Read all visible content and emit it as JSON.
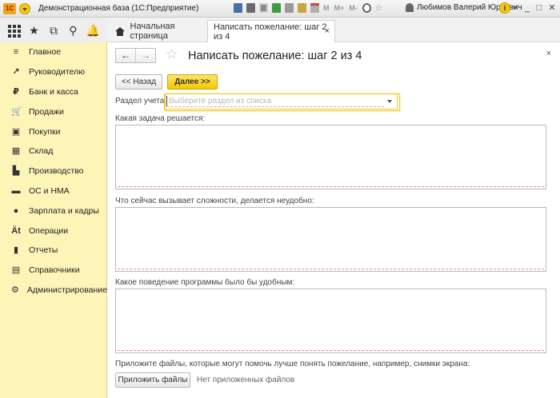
{
  "titlebar": {
    "logo_text": "1С",
    "app_title": "Демонстрационная база  (1С:Предприятие)",
    "m_buttons": [
      "M",
      "M+",
      "M-"
    ],
    "user_name": "Любимов Валерий Юрьевич",
    "info_glyph": "i",
    "minimize": "_",
    "maximize": "□",
    "close": "✕"
  },
  "topnav": {
    "home_tab": "Начальная страница",
    "active_tab": "Написать пожелание: шаг 2 из 4",
    "active_tab_close": "×"
  },
  "sidebar": {
    "items": [
      {
        "label": "Главное",
        "icon": "menu-lines-icon",
        "glyph": "≡"
      },
      {
        "label": "Руководителю",
        "icon": "trend-icon",
        "glyph": "↗"
      },
      {
        "label": "Банк и касса",
        "icon": "coin-icon",
        "glyph": "₽"
      },
      {
        "label": "Продажи",
        "icon": "cart-icon",
        "glyph": "🛒"
      },
      {
        "label": "Покупки",
        "icon": "bag-icon",
        "glyph": "▣"
      },
      {
        "label": "Склад",
        "icon": "warehouse-icon",
        "glyph": "▦"
      },
      {
        "label": "Производство",
        "icon": "factory-icon",
        "glyph": "▙"
      },
      {
        "label": "ОС и НМА",
        "icon": "truck-icon",
        "glyph": "▬"
      },
      {
        "label": "Зарплата и кадры",
        "icon": "person-icon",
        "glyph": "●"
      },
      {
        "label": "Операции",
        "icon": "operations-icon",
        "glyph": "Ät"
      },
      {
        "label": "Отчеты",
        "icon": "bar-chart-icon",
        "glyph": "▮"
      },
      {
        "label": "Справочники",
        "icon": "books-icon",
        "glyph": "▤"
      },
      {
        "label": "Администрирование",
        "icon": "gear-icon",
        "glyph": "⚙"
      }
    ]
  },
  "form": {
    "title": "Написать пожелание: шаг 2 из 4",
    "back_arrow": "←",
    "forward_arrow": "→",
    "star": "☆",
    "close": "×",
    "back_button": "<< Назад",
    "next_button": "Далее >>",
    "section_label": "Раздел учета:",
    "section_placeholder": "Выберите раздел из списка",
    "task_label": "Какая задача решается:",
    "difficulty_label": "Что сейчас вызывает сложности, делается неудобно:",
    "behavior_label": "Какое поведение программы было бы удобным:",
    "attach_hint": "Приложите файлы, которые могут помочь лучше понять пожелание, например, снимки экрана:",
    "attach_button": "Приложить файлы",
    "no_files": "Нет приложенных файлов"
  }
}
